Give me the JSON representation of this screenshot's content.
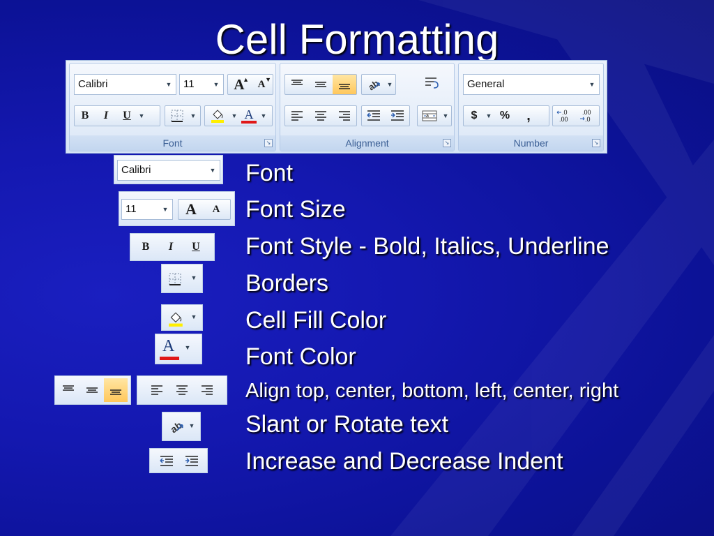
{
  "title": "Cell Formatting",
  "ribbon": {
    "font_group": {
      "label": "Font",
      "font_name": "Calibri",
      "font_size": "11",
      "grow_font": "A",
      "shrink_font": "A",
      "bold": "B",
      "italic": "I",
      "underline": "U",
      "font_color_glyph": "A",
      "fill_color": "#ffef00",
      "font_color": "#e01818"
    },
    "alignment_group": {
      "label": "Alignment"
    },
    "number_group": {
      "label": "Number",
      "format": "General",
      "currency": "$",
      "percent": "%",
      "comma": ","
    },
    "launcher_glyph": "↘"
  },
  "items": [
    {
      "label": "Font"
    },
    {
      "label": "Font Size"
    },
    {
      "label": "Font Style - Bold, Italics, Underline"
    },
    {
      "label": "Borders"
    },
    {
      "label": "Cell Fill Color"
    },
    {
      "label": "Font Color"
    },
    {
      "label": "Align top, center, bottom, left, center, right"
    },
    {
      "label": "Slant or Rotate text"
    },
    {
      "label": "Increase and Decrease Indent"
    }
  ],
  "colors": {
    "background": "#1418b0",
    "text": "#ffffff",
    "highlight": "#ffc75b"
  }
}
